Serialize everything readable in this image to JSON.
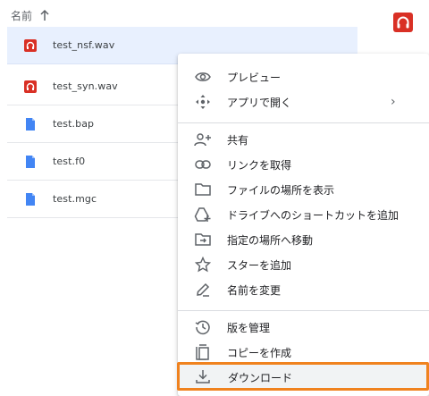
{
  "list": {
    "header": {
      "name_label": "名前"
    },
    "files": [
      {
        "name": "test_nsf.wav",
        "icon": "audio-file-icon",
        "selected": true
      },
      {
        "name": "test_syn.wav",
        "icon": "audio-file-icon",
        "selected": false
      },
      {
        "name": "test.bap",
        "icon": "doc-file-icon",
        "selected": false
      },
      {
        "name": "test.f0",
        "icon": "doc-file-icon",
        "selected": false
      },
      {
        "name": "test.mgc",
        "icon": "doc-file-icon",
        "selected": false
      }
    ]
  },
  "context_menu": {
    "preview": "プレビュー",
    "open_with": "アプリで開く",
    "open_with_chevron": "›",
    "share": "共有",
    "get_link": "リンクを取得",
    "show_location": "ファイルの場所を表示",
    "add_shortcut": "ドライブへのショートカットを追加",
    "move_to": "指定の場所へ移動",
    "add_star": "スターを追加",
    "rename": "名前を変更",
    "manage_versions": "版を管理",
    "make_copy": "コピーを作成",
    "download": "ダウンロード"
  },
  "colors": {
    "audio_red": "#d93025",
    "doc_blue": "#4285f4",
    "highlight_orange": "#f0821e",
    "selected_row": "#e8f0fe"
  }
}
